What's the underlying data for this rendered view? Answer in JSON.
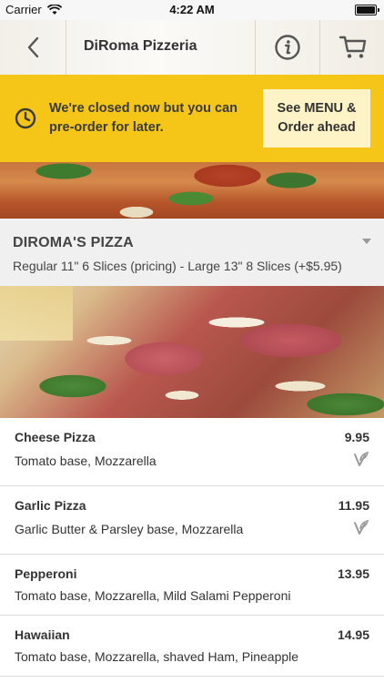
{
  "status_bar": {
    "carrier": "Carrier",
    "time": "4:22 AM"
  },
  "nav": {
    "title": "DiRoma Pizzeria",
    "icons": [
      "chevron-left-icon",
      "info-icon",
      "cart-icon"
    ]
  },
  "banner": {
    "message": "We're closed now but you can pre-order for later.",
    "cta_label": "See MENU & Order ahead",
    "color": "#f5c518"
  },
  "section": {
    "name": "DIROMA'S PIZZA",
    "description": "Regular 11\" 6 Slices (pricing) - Large 13\" 8 Slices (+$5.95)"
  },
  "items": [
    {
      "name": "Cheese Pizza",
      "price": "9.95",
      "description": "Tomato base, Mozzarella",
      "vegetarian": true
    },
    {
      "name": "Garlic Pizza",
      "price": "11.95",
      "description": "Garlic Butter & Parsley base, Mozzarella",
      "vegetarian": true
    },
    {
      "name": "Pepperoni",
      "price": "13.95",
      "description": "Tomato base, Mozzarella, Mild Salami Pepperoni",
      "vegetarian": false
    },
    {
      "name": "Hawaiian",
      "price": "14.95",
      "description": "Tomato base, Mozzarella, shaved Ham, Pineapple",
      "vegetarian": false
    }
  ]
}
